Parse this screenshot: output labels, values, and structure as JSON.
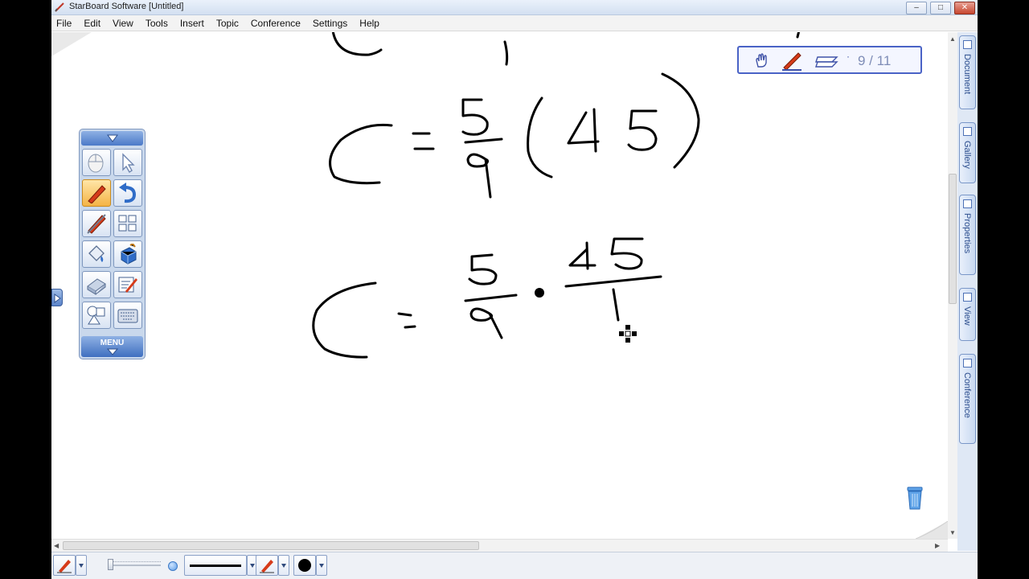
{
  "window": {
    "title": "StarBoard Software [Untitled]",
    "controls": {
      "minimize": "–",
      "maximize": "□",
      "close": "✕"
    }
  },
  "menu": [
    "File",
    "Edit",
    "View",
    "Tools",
    "Insert",
    "Topic",
    "Conference",
    "Settings",
    "Help"
  ],
  "page_navigator": {
    "current_page": 9,
    "total_pages": 11,
    "label": "9 / 11"
  },
  "toolbar": {
    "menu_label": "MENU",
    "tools": [
      {
        "name": "mouse-tool",
        "icon": "mouse-icon",
        "active": false
      },
      {
        "name": "select-tool",
        "icon": "pointer-arrow-icon",
        "active": false
      },
      {
        "name": "pen-tool",
        "icon": "pen-icon",
        "active": true
      },
      {
        "name": "undo-tool",
        "icon": "undo-icon",
        "active": false
      },
      {
        "name": "eraser-pen-tool",
        "icon": "pen-eraser-icon",
        "active": false
      },
      {
        "name": "page-sorter-tool",
        "icon": "grid-icon",
        "active": false
      },
      {
        "name": "fill-tool",
        "icon": "paint-bucket-icon",
        "active": false
      },
      {
        "name": "magic-tool",
        "icon": "cube-icon",
        "active": false
      },
      {
        "name": "eraser-tool",
        "icon": "eraser-icon",
        "active": false
      },
      {
        "name": "edit-tool",
        "icon": "edit-icon",
        "active": false
      },
      {
        "name": "shapes-tool",
        "icon": "shapes-icon",
        "active": false
      },
      {
        "name": "keyboard-tool",
        "icon": "keyboard-icon",
        "active": false
      }
    ]
  },
  "side_tabs": [
    "Document",
    "Gallery",
    "Properties",
    "View",
    "Conference"
  ],
  "colors": {
    "accent": "#4a63c6",
    "pen": "#d63b1a",
    "ink": "#000000",
    "toolbar_bg": "#c9d8ec"
  }
}
